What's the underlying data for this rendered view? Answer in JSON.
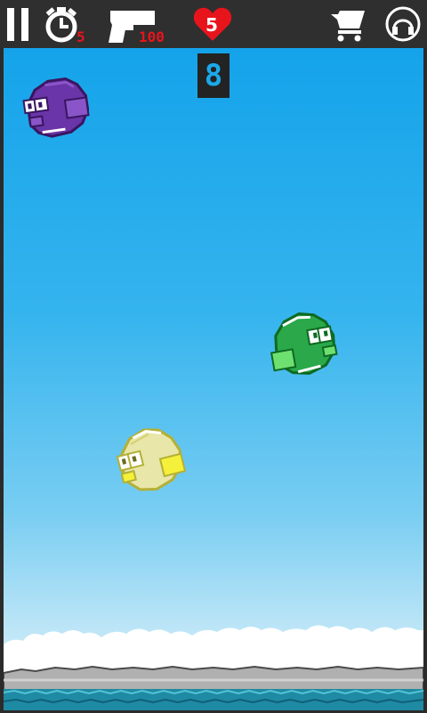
{
  "hud": {
    "timer_count": "5",
    "ammo_count": "100",
    "lives_count": "5"
  },
  "score": "8",
  "icons": {
    "pause": "pause-icon",
    "timer": "stopwatch-icon",
    "gun": "pistol-icon",
    "lives": "heart-icon",
    "shop": "cart-icon",
    "audio": "headphones-icon"
  },
  "birds": [
    {
      "name": "purple-bird",
      "body": "#6a35a8",
      "wing": "#8a55c8",
      "outline": "#3a1560"
    },
    {
      "name": "green-bird",
      "body": "#2aa84a",
      "wing": "#6ee070",
      "outline": "#0e6a22"
    },
    {
      "name": "yellow-bird",
      "body": "#e8e6a8",
      "wing": "#f5f03a",
      "outline": "#b4b036"
    }
  ],
  "colors": {
    "topbar": "#2f2f2f",
    "accent_red": "#e8141c",
    "sky_top": "#14a3ea",
    "sky_bottom": "#e8f6fb",
    "water": "#1f8aa3"
  }
}
